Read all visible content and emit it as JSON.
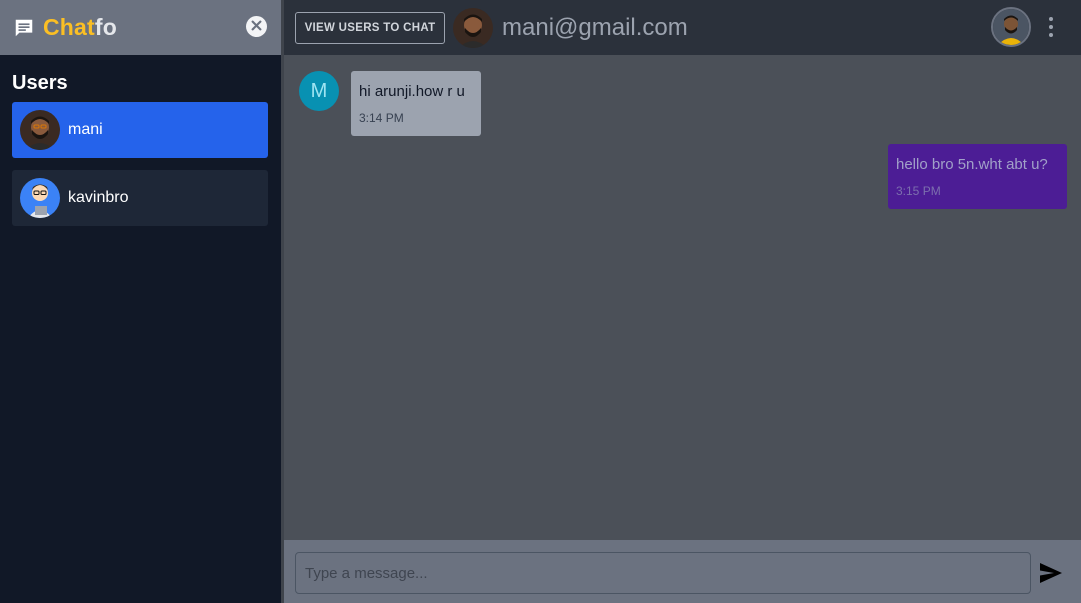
{
  "app": {
    "brand_part1": "Chat",
    "brand_part2": "fo",
    "logo_icon": "chat-bubble-icon",
    "close_icon": "close-icon"
  },
  "sidebar": {
    "heading": "Users",
    "users": [
      {
        "name": "mani",
        "avatar": "user-avatar",
        "active": true
      },
      {
        "name": "kavinbro",
        "avatar": "user-avatar",
        "active": false
      }
    ]
  },
  "topbar": {
    "view_users_label": "VIEW USERS TO CHAT",
    "chat_email": "mani@gmail.com",
    "menu_icon": "more-vertical-icon"
  },
  "messages": [
    {
      "direction": "in",
      "avatar_letter": "M",
      "text": "hi arunji.how r u",
      "time": "3:14 PM"
    },
    {
      "direction": "out",
      "text": "hello bro 5n.wht abt u?",
      "time": "3:15 PM"
    }
  ],
  "composer": {
    "placeholder": "Type a message...",
    "value": "",
    "send_icon": "send-icon"
  },
  "colors": {
    "sidebar_bg": "#111827",
    "active_user": "#2563eb",
    "brand_accent": "#fbbf24",
    "outgoing_bubble": "#4c1d95",
    "incoming_bubble": "#9ca3af"
  }
}
